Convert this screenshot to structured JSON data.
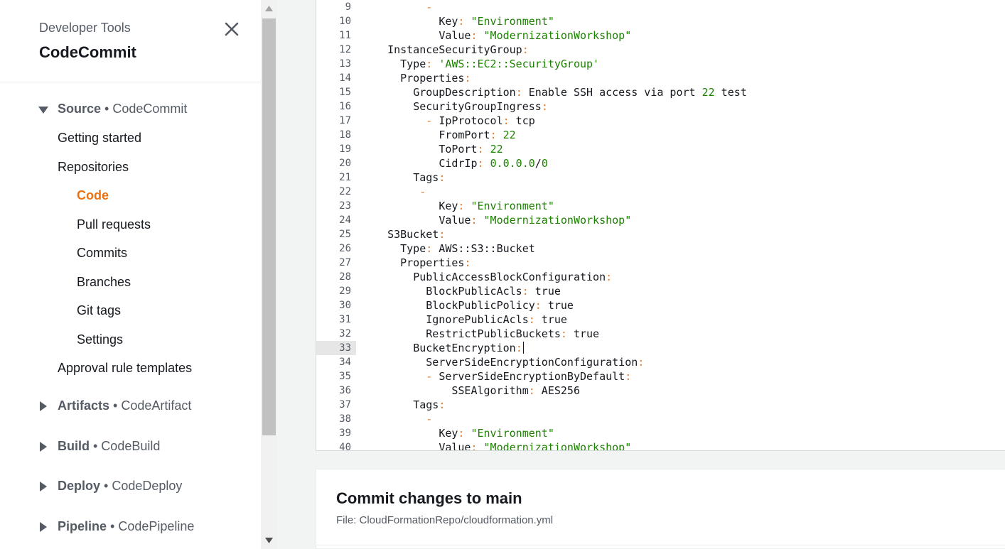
{
  "sidebar": {
    "kicker": "Developer Tools",
    "title": "CodeCommit",
    "close_icon": "close-icon",
    "source_section": {
      "name": "Source",
      "sub": " • CodeCommit"
    },
    "items": [
      {
        "label": "Getting started"
      },
      {
        "label": "Repositories"
      },
      {
        "label": "Code"
      },
      {
        "label": "Pull requests"
      },
      {
        "label": "Commits"
      },
      {
        "label": "Branches"
      },
      {
        "label": "Git tags"
      },
      {
        "label": "Settings"
      },
      {
        "label": "Approval rule templates"
      }
    ],
    "sections": [
      {
        "name": "Artifacts",
        "sub": " • CodeArtifact"
      },
      {
        "name": "Build",
        "sub": " • CodeBuild"
      },
      {
        "name": "Deploy",
        "sub": " • CodeDeploy"
      },
      {
        "name": "Pipeline",
        "sub": " • CodePipeline"
      }
    ]
  },
  "editor": {
    "lines": [
      {
        "n": "9",
        "t": "        -"
      },
      {
        "n": "10",
        "t": "          Key: \"Environment\""
      },
      {
        "n": "11",
        "t": "          Value: \"ModernizationWorkshop\""
      },
      {
        "n": "12",
        "t": "  InstanceSecurityGroup:"
      },
      {
        "n": "13",
        "t": "    Type: 'AWS::EC2::SecurityGroup'"
      },
      {
        "n": "14",
        "t": "    Properties:"
      },
      {
        "n": "15",
        "t": "      GroupDescription: Enable SSH access via port 22 test"
      },
      {
        "n": "16",
        "t": "      SecurityGroupIngress:"
      },
      {
        "n": "17",
        "t": "        - IpProtocol: tcp"
      },
      {
        "n": "18",
        "t": "          FromPort: 22"
      },
      {
        "n": "19",
        "t": "          ToPort: 22"
      },
      {
        "n": "20",
        "t": "          CidrIp: 0.0.0.0/0"
      },
      {
        "n": "21",
        "t": "      Tags:"
      },
      {
        "n": "22",
        "t": "       -"
      },
      {
        "n": "23",
        "t": "          Key: \"Environment\""
      },
      {
        "n": "24",
        "t": "          Value: \"ModernizationWorkshop\""
      },
      {
        "n": "25",
        "t": "  S3Bucket:"
      },
      {
        "n": "26",
        "t": "    Type: AWS::S3::Bucket"
      },
      {
        "n": "27",
        "t": "    Properties:"
      },
      {
        "n": "28",
        "t": "      PublicAccessBlockConfiguration:"
      },
      {
        "n": "29",
        "t": "        BlockPublicAcls: true"
      },
      {
        "n": "30",
        "t": "        BlockPublicPolicy: true"
      },
      {
        "n": "31",
        "t": "        IgnorePublicAcls: true"
      },
      {
        "n": "32",
        "t": "        RestrictPublicBuckets: true"
      },
      {
        "n": "33",
        "t": "      BucketEncryption:"
      },
      {
        "n": "34",
        "t": "        ServerSideEncryptionConfiguration:"
      },
      {
        "n": "35",
        "t": "        - ServerSideEncryptionByDefault:"
      },
      {
        "n": "36",
        "t": "            SSEAlgorithm: AES256"
      },
      {
        "n": "37",
        "t": "      Tags:"
      },
      {
        "n": "38",
        "t": "        -"
      },
      {
        "n": "39",
        "t": "          Key: \"Environment\""
      },
      {
        "n": "40",
        "t": "          Value: \"ModernizationWorkshop\""
      }
    ],
    "current_line": "33"
  },
  "commit": {
    "title": "Commit changes to main",
    "file": "File: CloudFormationRepo/cloudformation.yml"
  },
  "colors": {
    "accent_active": "#ec7211",
    "yaml_key": "#16191f",
    "yaml_punct": "#e07a2f",
    "yaml_string": "#1d8102"
  }
}
